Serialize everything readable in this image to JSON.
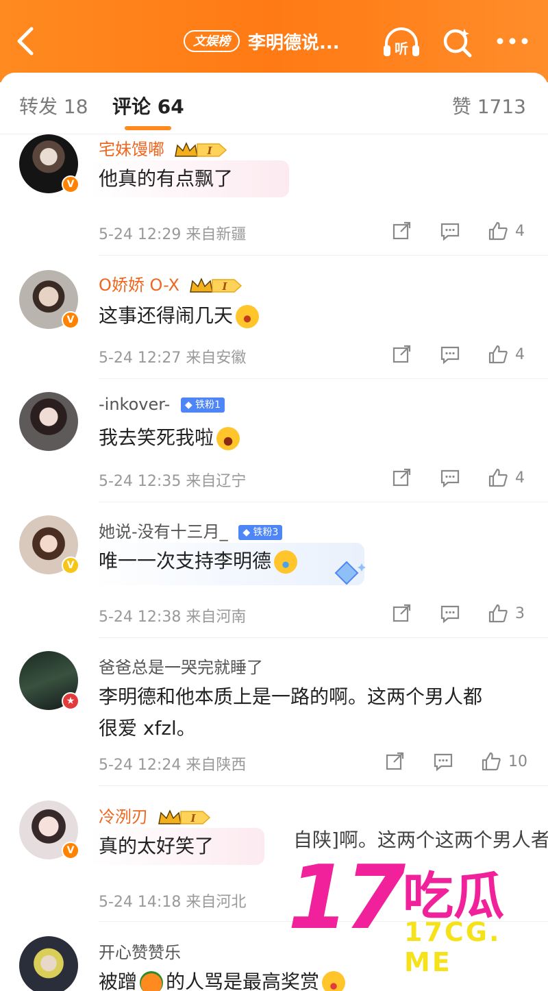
{
  "header": {
    "rank_badge": "文娱榜",
    "title": "李明德说...",
    "listen_label": "听"
  },
  "tabs": {
    "repost": "转发 18",
    "comment": "评论 64",
    "like": "赞 1713"
  },
  "comments": [
    {
      "username": "宅妹馒嘟",
      "text": "他真的有点飘了",
      "time": "5-24 12:29",
      "location": "来自新疆",
      "likes": "4"
    },
    {
      "username": "O娇娇 O-X",
      "text": "这事还得闹几天",
      "time": "5-24 12:27",
      "location": "来自安徽",
      "likes": "4"
    },
    {
      "username": "-inkover-",
      "fan_badge": "铁粉1",
      "text": "我去笑死我啦",
      "time": "5-24 12:35",
      "location": "来自辽宁",
      "likes": "4"
    },
    {
      "username": "她说-没有十三月_",
      "fan_badge": "铁粉3",
      "text": "唯一一次支持李明德",
      "time": "5-24 12:38",
      "location": "来自河南",
      "likes": "3"
    },
    {
      "username": "爸爸总是一哭完就睡了",
      "text_line1": "李明德和他本质上是一路的啊。这两个男人都",
      "text_line2": "很爱 xfzl。",
      "time": "5-24 12:24",
      "location": "来自陕西",
      "likes": "10"
    },
    {
      "username": "冷洌刃",
      "text": "真的太好笑了",
      "time": "5-24 14:18",
      "location": "来自河北",
      "likes": ""
    },
    {
      "username": "开心赞赞乐",
      "text_a": "被蹭",
      "text_b": "的人骂是最高奖赏"
    }
  ],
  "overlay": {
    "ghost_text": "自陕]啊。这两个这两个男人者"
  },
  "watermark": {
    "number": "17",
    "chinese": "吃瓜",
    "url": "17CG. ME"
  },
  "colors": {
    "header_orange": "#ff8a1f",
    "username_orange": "#f0661e",
    "watermark_pink": "#f0219a",
    "watermark_yellow": "#f5e21a"
  }
}
